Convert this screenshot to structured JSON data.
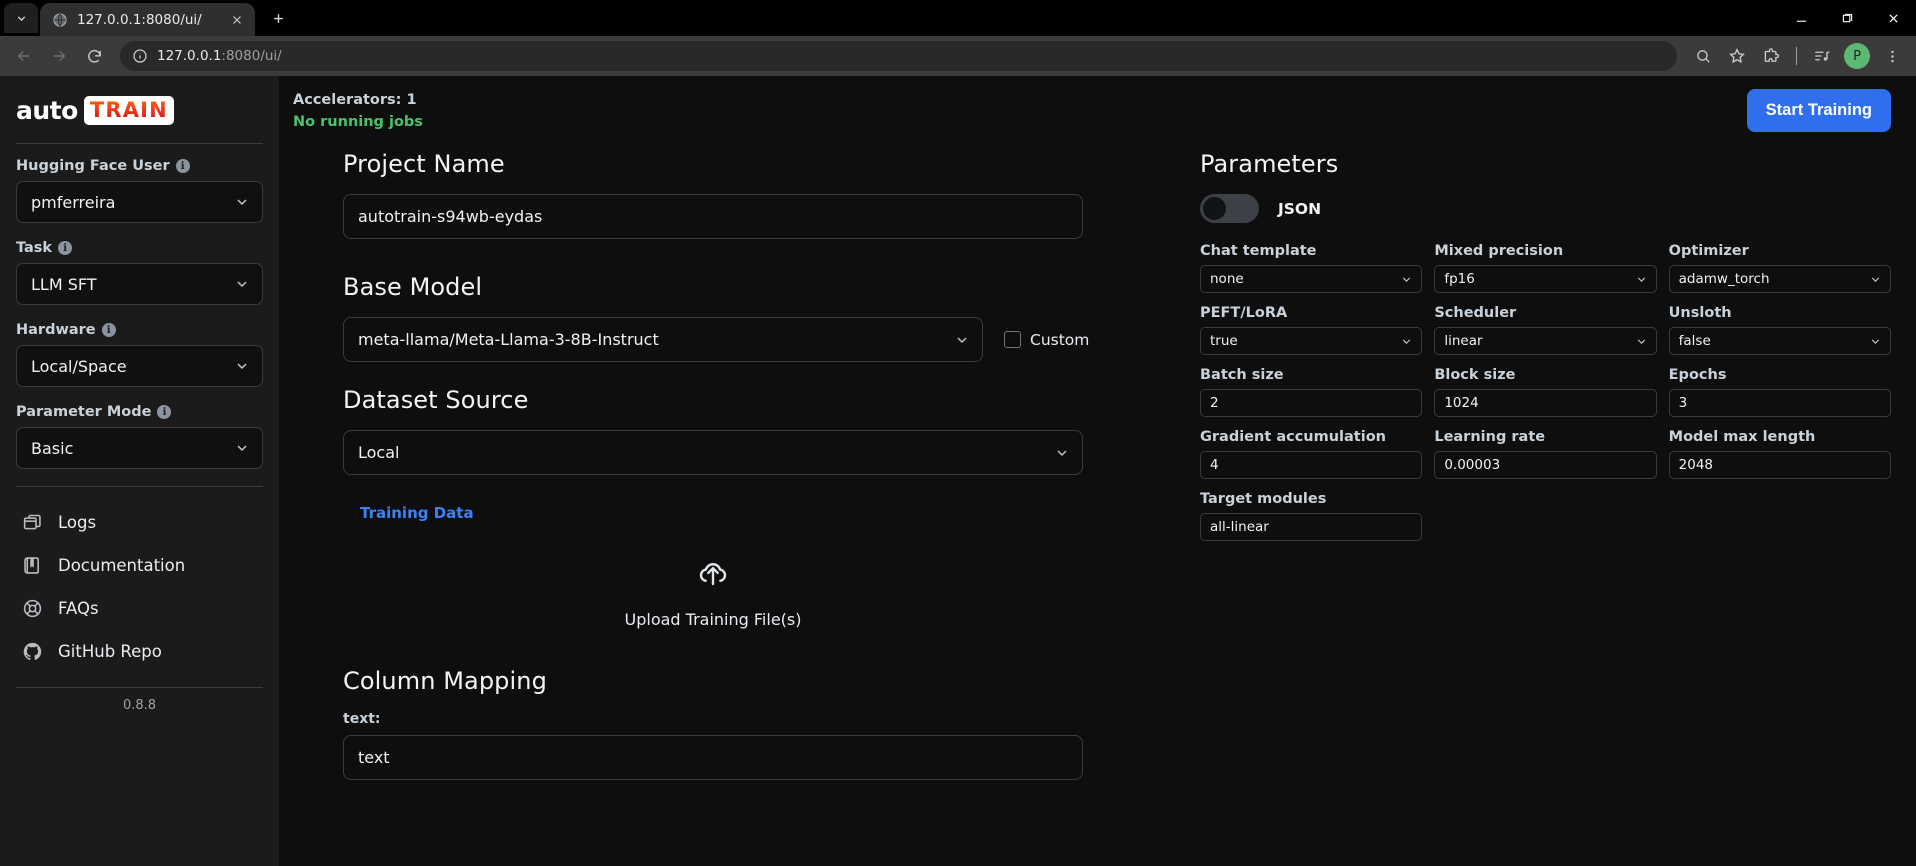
{
  "browser": {
    "tab": {
      "title": "127.0.0.1:8080/ui/",
      "favicon_icon": "globe-icon",
      "close_icon": "close-icon"
    },
    "tab_list_icon": "chevron-down-icon",
    "new_tab_icon": "plus-icon",
    "window_controls": {
      "minimize": "minimize-icon",
      "maximize": "maximize-icon",
      "close": "close-icon"
    },
    "nav": {
      "back_icon": "arrow-left-icon",
      "forward_icon": "arrow-right-icon",
      "reload_icon": "reload-icon"
    },
    "omnibox": {
      "info_icon": "info-circle-icon",
      "host": "127.0.0.1",
      "rest": ":8080/ui/"
    },
    "actions": {
      "zoom_icon": "zoom-magnifier-icon",
      "bookmark_icon": "star-icon",
      "extensions_icon": "extensions-puzzle-icon",
      "media_icon": "media-list-icon",
      "profile_initial": "P",
      "menu_icon": "kebab-menu-icon"
    }
  },
  "sidebar": {
    "logo": {
      "auto": "auto",
      "train": "TRAIN"
    },
    "fields": [
      {
        "label": "Hugging Face User",
        "info_icon": "info-icon",
        "value": "pmferreira",
        "name": "hugging-face-user"
      },
      {
        "label": "Task",
        "info_icon": "info-icon",
        "value": "LLM SFT",
        "name": "task"
      },
      {
        "label": "Hardware",
        "info_icon": "info-icon",
        "value": "Local/Space",
        "name": "hardware"
      },
      {
        "label": "Parameter Mode",
        "info_icon": "info-icon",
        "value": "Basic",
        "name": "parameter-mode"
      }
    ],
    "nav": [
      {
        "label": "Logs",
        "icon": "logs-window-icon"
      },
      {
        "label": "Documentation",
        "icon": "book-icon"
      },
      {
        "label": "FAQs",
        "icon": "lifebuoy-icon"
      },
      {
        "label": "GitHub Repo",
        "icon": "github-icon"
      }
    ],
    "version": "0.8.8"
  },
  "topbar": {
    "accelerators_label": "Accelerators: 1",
    "jobs_status": "No running jobs",
    "start_button": "Start Training",
    "accent_blue": "#2f6fed",
    "status_green": "#4ac26b"
  },
  "form": {
    "project_name": {
      "title": "Project Name",
      "value": "autotrain-s94wb-eydas"
    },
    "base_model": {
      "title": "Base Model",
      "value": "meta-llama/Meta-Llama-3-8B-Instruct",
      "custom_label": "Custom",
      "custom_checked": false
    },
    "dataset_source": {
      "title": "Dataset Source",
      "value": "Local"
    },
    "training_data_tab": "Training Data",
    "upload": {
      "icon": "cloud-upload-icon",
      "label": "Upload Training File(s)"
    },
    "column_mapping": {
      "title": "Column Mapping",
      "field_label": "text:",
      "value": "text"
    }
  },
  "parameters": {
    "title": "Parameters",
    "json_toggle": {
      "label": "JSON",
      "on": false
    },
    "items": [
      {
        "label": "Chat template",
        "value": "none",
        "kind": "select"
      },
      {
        "label": "Mixed precision",
        "value": "fp16",
        "kind": "select"
      },
      {
        "label": "Optimizer",
        "value": "adamw_torch",
        "kind": "select"
      },
      {
        "label": "PEFT/LoRA",
        "value": "true",
        "kind": "select"
      },
      {
        "label": "Scheduler",
        "value": "linear",
        "kind": "select"
      },
      {
        "label": "Unsloth",
        "value": "false",
        "kind": "select"
      },
      {
        "label": "Batch size",
        "value": "2",
        "kind": "input"
      },
      {
        "label": "Block size",
        "value": "1024",
        "kind": "input"
      },
      {
        "label": "Epochs",
        "value": "3",
        "kind": "input"
      },
      {
        "label": "Gradient accumulation",
        "value": "4",
        "kind": "input"
      },
      {
        "label": "Learning rate",
        "value": "0.00003",
        "kind": "input"
      },
      {
        "label": "Model max length",
        "value": "2048",
        "kind": "input"
      },
      {
        "label": "Target modules",
        "value": "all-linear",
        "kind": "input"
      }
    ]
  }
}
